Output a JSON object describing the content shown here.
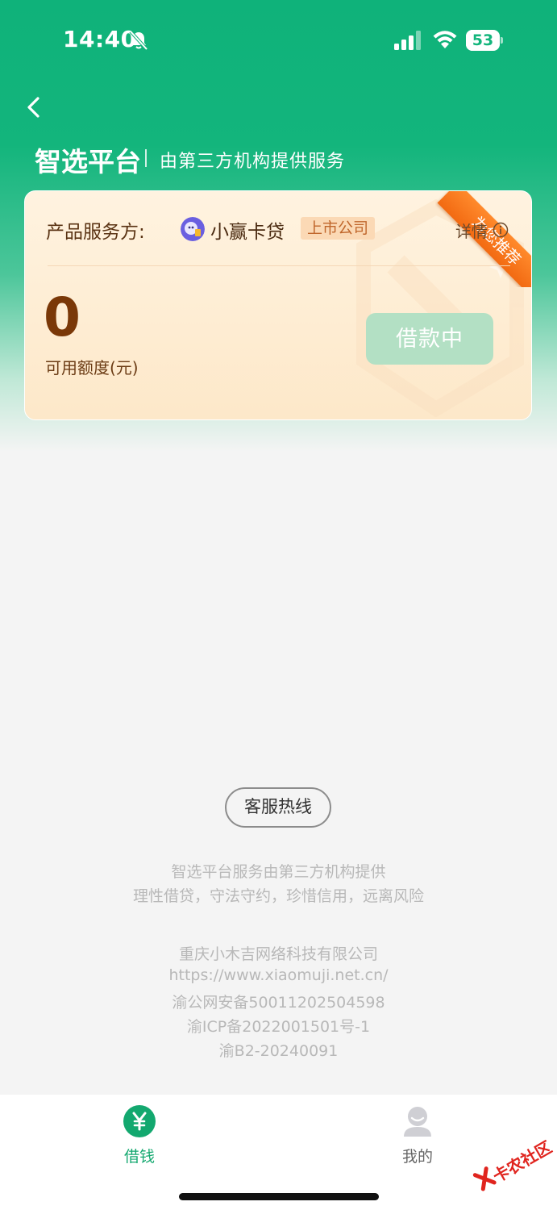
{
  "status_bar": {
    "time": "14:40",
    "battery": "53"
  },
  "header": {
    "title": "智选平台",
    "subtitle": "由第三方机构提供服务"
  },
  "card": {
    "ribbon": "为您推荐",
    "provider_label": "产品服务方:",
    "provider_name": "小赢卡贷",
    "provider_badge": "上市公司",
    "details_label": "详情",
    "credit_amount": "0",
    "credit_label": "可用额度(元)",
    "button_label": "借款中"
  },
  "footer": {
    "hotline_label": "客服热线",
    "notices": [
      "智选平台服务由第三方机构提供",
      "理性借贷，守法守约，珍惜信用，远离风险"
    ],
    "company_info": [
      "重庆小木吉网络科技有限公司",
      "https://www.xiaomuji.net.cn/",
      "渝公网安备50011202504598",
      "渝ICP备2022001501号-1",
      "渝B2-20240091"
    ]
  },
  "tab_bar": {
    "tabs": [
      {
        "label": "借钱",
        "icon": "yen-icon",
        "active": true
      },
      {
        "label": "我的",
        "icon": "user-icon",
        "active": false
      }
    ]
  },
  "watermark": "卡农社区",
  "colors": {
    "brand_green": "#13b57c",
    "button_disabled": "#b3e0c4",
    "ribbon_orange": "#f26a12",
    "amount_brown": "#7a3808"
  }
}
